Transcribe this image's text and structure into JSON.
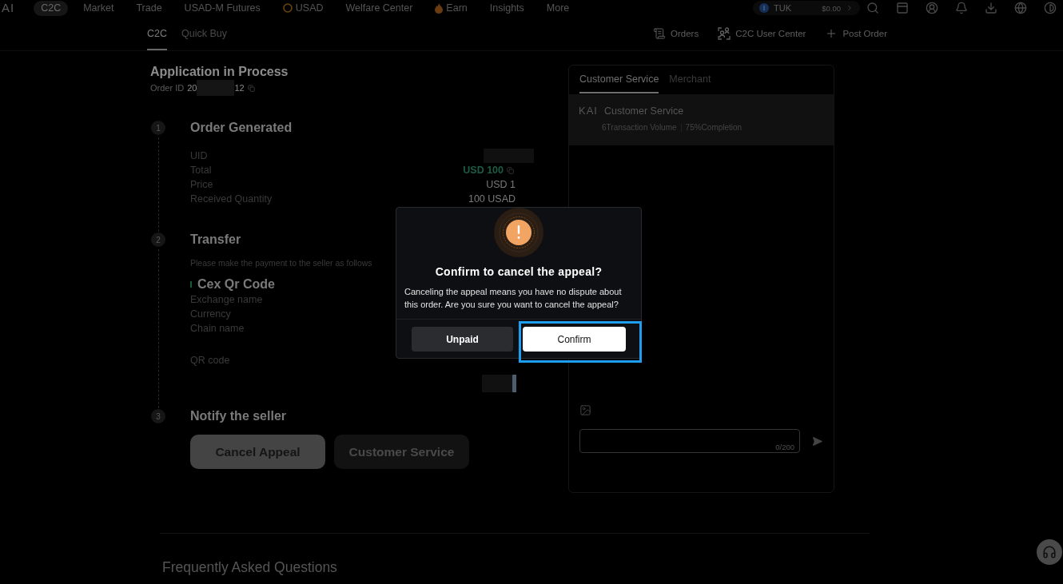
{
  "top_nav": {
    "logo": "AI",
    "items": [
      {
        "label": "C2C",
        "selected": true,
        "kind": "text"
      },
      {
        "label": "Market",
        "selected": false,
        "kind": "text"
      },
      {
        "label": "Trade",
        "selected": false,
        "kind": "text"
      },
      {
        "label": "USAD-M Futures",
        "selected": false,
        "kind": "text"
      },
      {
        "label": "USAD",
        "selected": false,
        "kind": "coin"
      },
      {
        "label": "Welfare Center",
        "selected": false,
        "kind": "text"
      },
      {
        "label": "Earn",
        "selected": false,
        "kind": "flame"
      },
      {
        "label": "Insights",
        "selected": false,
        "kind": "text"
      },
      {
        "label": "More",
        "selected": false,
        "kind": "text"
      }
    ],
    "wallet": {
      "currency": "TUK",
      "balance": "$0.00"
    }
  },
  "sub_nav": {
    "tabs": [
      {
        "label": "C2C",
        "selected": true
      },
      {
        "label": "Quick Buy",
        "selected": false
      }
    ],
    "links": [
      {
        "label": "Orders",
        "kind": "orders"
      },
      {
        "label": "C2C User Center",
        "kind": "user-center"
      },
      {
        "label": "Post Order",
        "kind": "post"
      }
    ]
  },
  "order": {
    "title": "Application in Process",
    "id_label": "Order ID",
    "id_start": "20",
    "id_end": "12"
  },
  "steps": [
    {
      "number": "1",
      "title": "Order Generated",
      "rows": [
        {
          "label": "UID",
          "kind": "redacted"
        },
        {
          "label": "Total",
          "kind": "amount",
          "value": "USD 100"
        },
        {
          "label": "Price",
          "kind": "text",
          "value": "USD 1"
        },
        {
          "label": "Received Quantity",
          "kind": "text",
          "value": "100 USAD"
        }
      ]
    },
    {
      "number": "2",
      "title": "Transfer",
      "note": "Please make the payment to the seller as follows",
      "method": "Cex Qr Code",
      "rows": [
        {
          "label": "Exchange name",
          "kind": "text"
        },
        {
          "label": "Currency",
          "kind": "text"
        },
        {
          "label": "Chain name",
          "kind": "text"
        },
        {
          "label": "QR code",
          "kind": "image"
        }
      ]
    },
    {
      "number": "3",
      "title": "Notify the seller",
      "buttons": [
        {
          "label": "Cancel Appeal",
          "kind": "primary"
        },
        {
          "label": "Customer Service",
          "kind": "secondary"
        }
      ]
    }
  ],
  "faq": {
    "title": "Frequently Asked Questions"
  },
  "chat": {
    "tabs": [
      {
        "label": "Customer Service",
        "selected": true
      },
      {
        "label": "Merchant",
        "selected": false
      }
    ],
    "contact": {
      "logo": "KAI",
      "name": "Customer Service",
      "volume": "6Transaction Volume",
      "completion": "75%Completion"
    },
    "input": {
      "counter": "0/200"
    }
  },
  "dialog": {
    "title": "Confirm to cancel the appeal?",
    "message": "Canceling the appeal means you have no dispute about this order. Are you sure you want to cancel the appeal?",
    "buttons": [
      {
        "label": "Unpaid",
        "kind": "secondary",
        "focused": false
      },
      {
        "label": "Confirm",
        "kind": "primary",
        "focused": true
      }
    ]
  }
}
